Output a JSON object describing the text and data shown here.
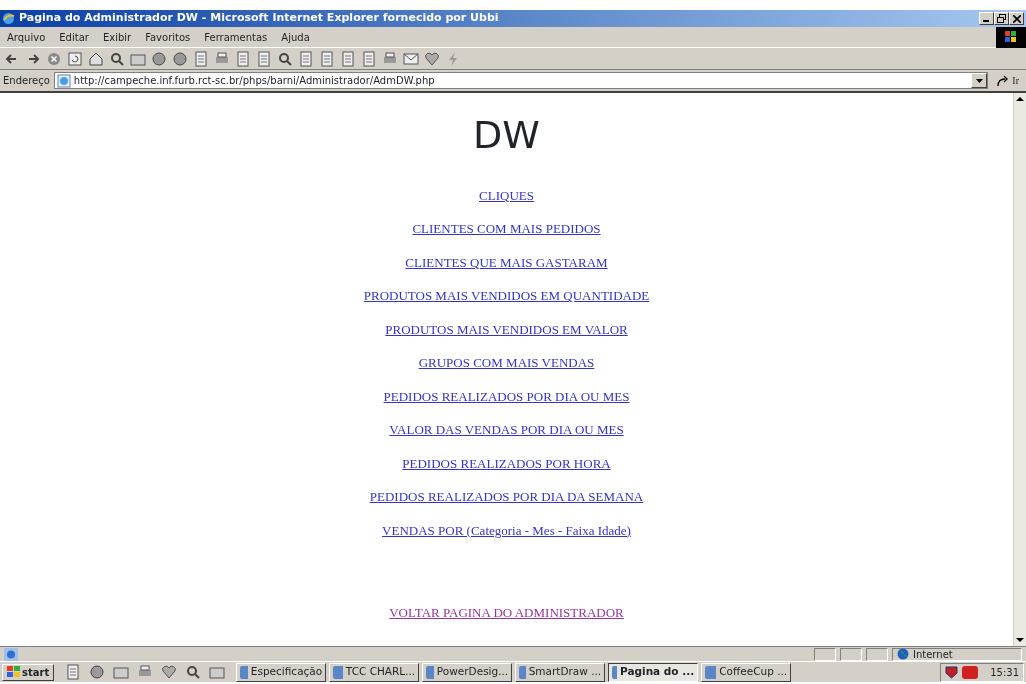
{
  "window": {
    "title": "Pagina do Administrador DW - Microsoft Internet Explorer fornecido por Ubbi"
  },
  "menu": [
    "Arquivo",
    "Editar",
    "Exibir",
    "Favoritos",
    "Ferramentas",
    "Ajuda"
  ],
  "address_bar": {
    "label": "Endereço",
    "url": "http://campeche.inf.furb.rct-sc.br/phps/barni/Administrador/AdmDW.php",
    "go_button": "Ir"
  },
  "page": {
    "heading": "DW",
    "links": [
      {
        "text": "CLIQUES",
        "visited": false
      },
      {
        "text": "CLIENTES COM MAIS PEDIDOS",
        "visited": false
      },
      {
        "text": "CLIENTES QUE MAIS GASTARAM",
        "visited": false
      },
      {
        "text": "PRODUTOS MAIS VENDIDOS EM QUANTIDADE",
        "visited": false
      },
      {
        "text": "PRODUTOS MAIS VENDIDOS EM VALOR",
        "visited": false
      },
      {
        "text": "GRUPOS COM MAIS VENDAS",
        "visited": false
      },
      {
        "text": "PEDIDOS REALIZADOS POR DIA OU MES",
        "visited": false
      },
      {
        "text": "VALOR DAS VENDAS POR DIA OU MES",
        "visited": false
      },
      {
        "text": "PEDIDOS REALIZADOS POR HORA",
        "visited": false
      },
      {
        "text": "PEDIDOS REALIZADOS POR DIA DA SEMANA",
        "visited": false
      },
      {
        "text": "VENDAS POR (Categoria - Mes - Faixa Idade)",
        "visited": false
      }
    ],
    "back_link": {
      "text": "VOLTAR PAGINA DO ADMINISTRADOR",
      "visited": true
    }
  },
  "status_bar": {
    "zone": "Internet"
  },
  "taskbar": {
    "start": "start",
    "tasks": [
      {
        "label": "Especificação",
        "selected": false
      },
      {
        "label": "TCC CHARL...",
        "selected": false
      },
      {
        "label": "PowerDesig...",
        "selected": false
      },
      {
        "label": "SmartDraw ...",
        "selected": false
      },
      {
        "label": "Pagina do ...",
        "selected": true
      },
      {
        "label": "CoffeeCup ...",
        "selected": false
      }
    ],
    "clock": "15:31"
  }
}
